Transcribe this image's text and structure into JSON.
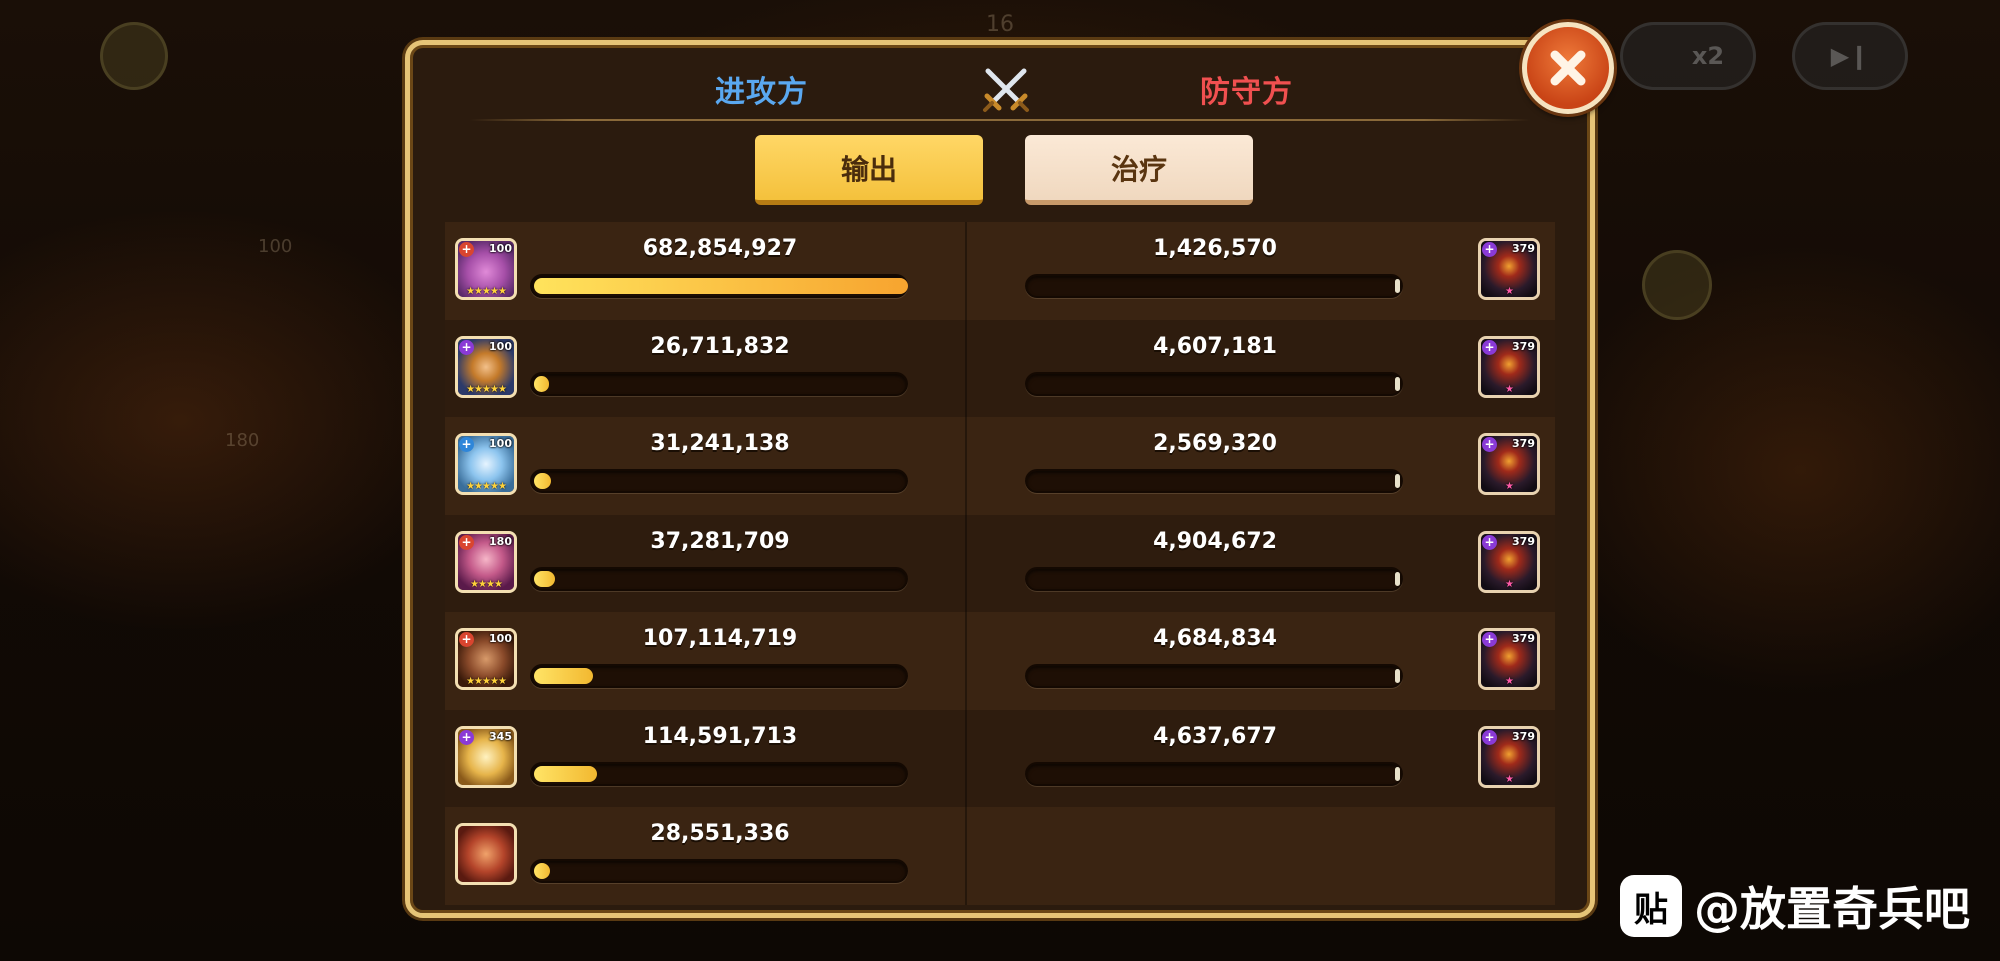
{
  "header": {
    "attacker_label": "进攻方",
    "defender_label": "防守方",
    "swords_icon": "crossed-swords-icon"
  },
  "tabs": {
    "damage_label": "输出",
    "heal_label": "治疗",
    "selected": "damage"
  },
  "background": {
    "speed_label": "x2",
    "side_numbers": [
      "100",
      "180"
    ],
    "top_number": "16"
  },
  "attackers": [
    {
      "value": "682,854,927",
      "level": "100",
      "faction": "red",
      "stars": "★★★★★",
      "portrait": "purple-demon",
      "fill": 1.0
    },
    {
      "value": "26,711,832",
      "level": "100",
      "faction": "purple",
      "stars": "★★★★★",
      "portrait": "masked-warrior",
      "fill": 0.039
    },
    {
      "value": "31,241,138",
      "level": "100",
      "faction": "blue",
      "stars": "★★★★★",
      "portrait": "ice-golem",
      "fill": 0.046
    },
    {
      "value": "37,281,709",
      "level": "180",
      "faction": "red",
      "stars": "★★★★",
      "portrait": "pink-witch",
      "fill": 0.055
    },
    {
      "value": "107,114,719",
      "level": "100",
      "faction": "red",
      "stars": "★★★★★",
      "portrait": "brown-beast",
      "fill": 0.157
    },
    {
      "value": "114,591,713",
      "level": "345",
      "faction": "purple",
      "stars": "",
      "portrait": "golden-sage",
      "fill": 0.168
    },
    {
      "value": "28,551,336",
      "level": "",
      "faction": "",
      "stars": "",
      "portrait": "horned-ogre",
      "fill": 0.042
    }
  ],
  "defenders": [
    {
      "value": "1,426,570",
      "level": "379",
      "faction": "purple",
      "stars": "★",
      "portrait": "dark-lord"
    },
    {
      "value": "4,607,181",
      "level": "379",
      "faction": "purple",
      "stars": "★",
      "portrait": "dark-lord"
    },
    {
      "value": "2,569,320",
      "level": "379",
      "faction": "purple",
      "stars": "★",
      "portrait": "dark-lord"
    },
    {
      "value": "4,904,672",
      "level": "379",
      "faction": "purple",
      "stars": "★",
      "portrait": "dark-lord"
    },
    {
      "value": "4,684,834",
      "level": "379",
      "faction": "purple",
      "stars": "★",
      "portrait": "dark-lord"
    },
    {
      "value": "4,637,677",
      "level": "379",
      "faction": "purple",
      "stars": "★",
      "portrait": "dark-lord"
    }
  ],
  "colors": {
    "attacker": "#5aa8f0",
    "defender": "#f05050",
    "bar_fill": "#f2b830",
    "panel_border": "#e6c477"
  },
  "watermark": {
    "icon_text": "贴",
    "text": "@放置奇兵吧"
  }
}
